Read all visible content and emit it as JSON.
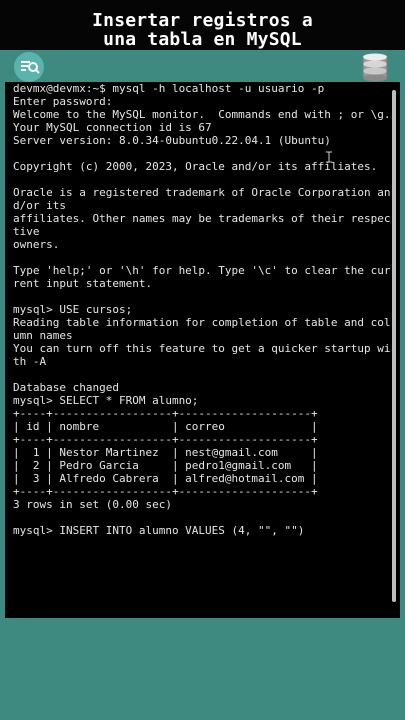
{
  "video_title": {
    "line1": "Insertar registros a",
    "line2": "una tabla en MySQL"
  },
  "icons": {
    "left": "search-list-icon",
    "right": "database-icon"
  },
  "colors": {
    "background": "#3e8a80",
    "terminal_bg": "#000000",
    "terminal_text": "#e6e6e6",
    "search_badge": "#5ab4ad"
  },
  "terminal": {
    "lines": [
      "devmx@devmx:~$ mysql -h localhost -u usuario -p",
      "Enter password:",
      "Welcome to the MySQL monitor.  Commands end with ; or \\g.",
      "Your MySQL connection id is 67",
      "Server version: 8.0.34-0ubuntu0.22.04.1 (Ubuntu)",
      "",
      "Copyright (c) 2000, 2023, Oracle and/or its affiliates.",
      "",
      "Oracle is a registered trademark of Oracle Corporation an",
      "d/or its",
      "affiliates. Other names may be trademarks of their respec",
      "tive",
      "owners.",
      "",
      "Type 'help;' or '\\h' for help. Type '\\c' to clear the cur",
      "rent input statement.",
      "",
      "mysql> USE cursos;",
      "Reading table information for completion of table and col",
      "umn names",
      "You can turn off this feature to get a quicker startup wi",
      "th -A",
      "",
      "Database changed",
      "mysql> SELECT * FROM alumno;",
      "+----+------------------+--------------------+",
      "| id | nombre           | correo             |",
      "+----+------------------+--------------------+",
      "|  1 | Nestor Martinez  | nest@gmail.com     |",
      "|  2 | Pedro Garcia     | pedro1@gmail.com   |",
      "|  3 | Alfredo Cabrera  | alfred@hotmail.com |",
      "+----+------------------+--------------------+",
      "3 rows in set (0.00 sec)",
      "",
      "mysql> INSERT INTO alumno VALUES (4, \"\", \"\")"
    ]
  }
}
